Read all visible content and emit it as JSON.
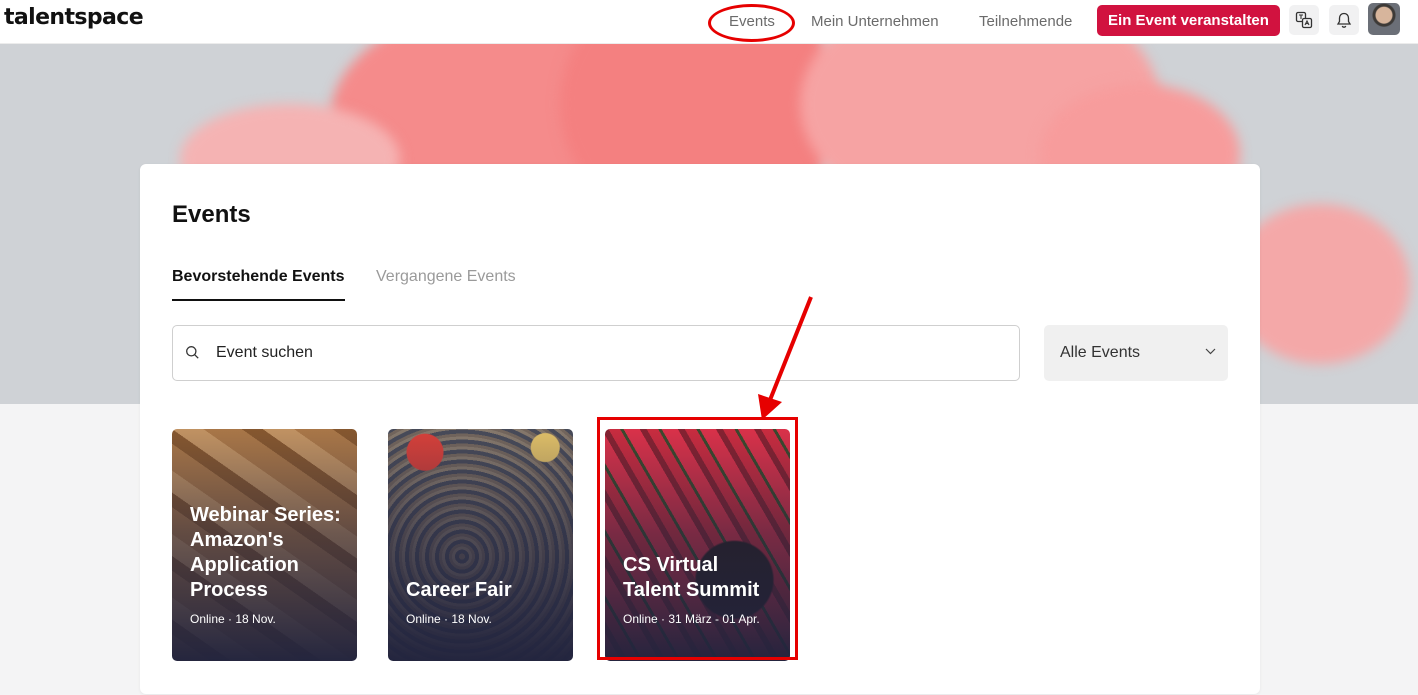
{
  "app": {
    "logo": "talentspace"
  },
  "topnav": {
    "links": [
      "Events",
      "Mein Unternehmen",
      "Teilnehmende"
    ],
    "cta_label": "Ein Event veranstalten"
  },
  "page": {
    "title": "Events",
    "tabs": [
      {
        "label": "Bevorstehende Events",
        "active": true
      },
      {
        "label": "Vergangene Events",
        "active": false
      }
    ]
  },
  "search": {
    "value": "Event suchen"
  },
  "filter": {
    "selected": "Alle Events"
  },
  "events": [
    {
      "title": "Webinar Series: Amazon's Application Process",
      "meta": "Online · 18 Nov."
    },
    {
      "title": "Career Fair",
      "meta": "Online · 18 Nov."
    },
    {
      "title": "CS Virtual Talent Summit",
      "meta": "Online · 31 März - 01 Apr."
    }
  ],
  "colors": {
    "accent": "#d1123f",
    "annotation": "#e60000",
    "card_overlay": "#22243e"
  },
  "icons": [
    "translate-icon",
    "bell-icon",
    "search-icon",
    "chevron-down-icon"
  ]
}
